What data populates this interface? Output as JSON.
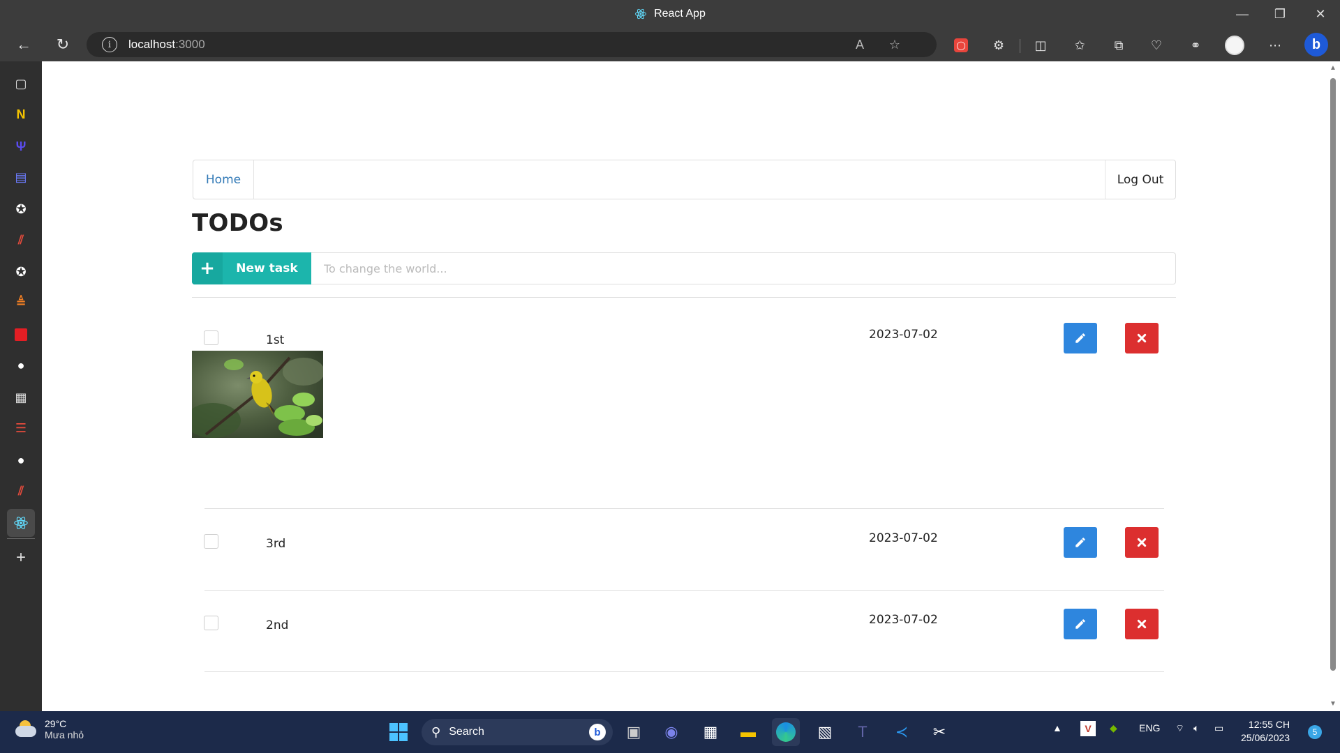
{
  "browser": {
    "window_title": "React App",
    "url_host": "localhost",
    "url_port": ":3000"
  },
  "app": {
    "nav": {
      "home": "Home",
      "logout": "Log Out"
    },
    "title": "TODOs",
    "new_task": {
      "button_label": "New task",
      "placeholder": "To change the world..."
    },
    "todos": [
      {
        "label": "1st",
        "date": "2023-07-02",
        "has_image": true,
        "checked": false
      },
      {
        "label": "3rd",
        "date": "2023-07-02",
        "has_image": false,
        "checked": false
      },
      {
        "label": "2nd",
        "date": "2023-07-02",
        "has_image": false,
        "checked": false
      }
    ],
    "colors": {
      "accent": "#1cb5ac",
      "edit": "#2e86de",
      "delete": "#dc2f2f",
      "link": "#337ab7"
    }
  },
  "taskbar": {
    "weather_temp": "29°C",
    "weather_desc": "Mưa nhỏ",
    "search_label": "Search",
    "language": "ENG",
    "time": "12:55 CH",
    "date": "25/06/2023",
    "notification_count": "5"
  }
}
